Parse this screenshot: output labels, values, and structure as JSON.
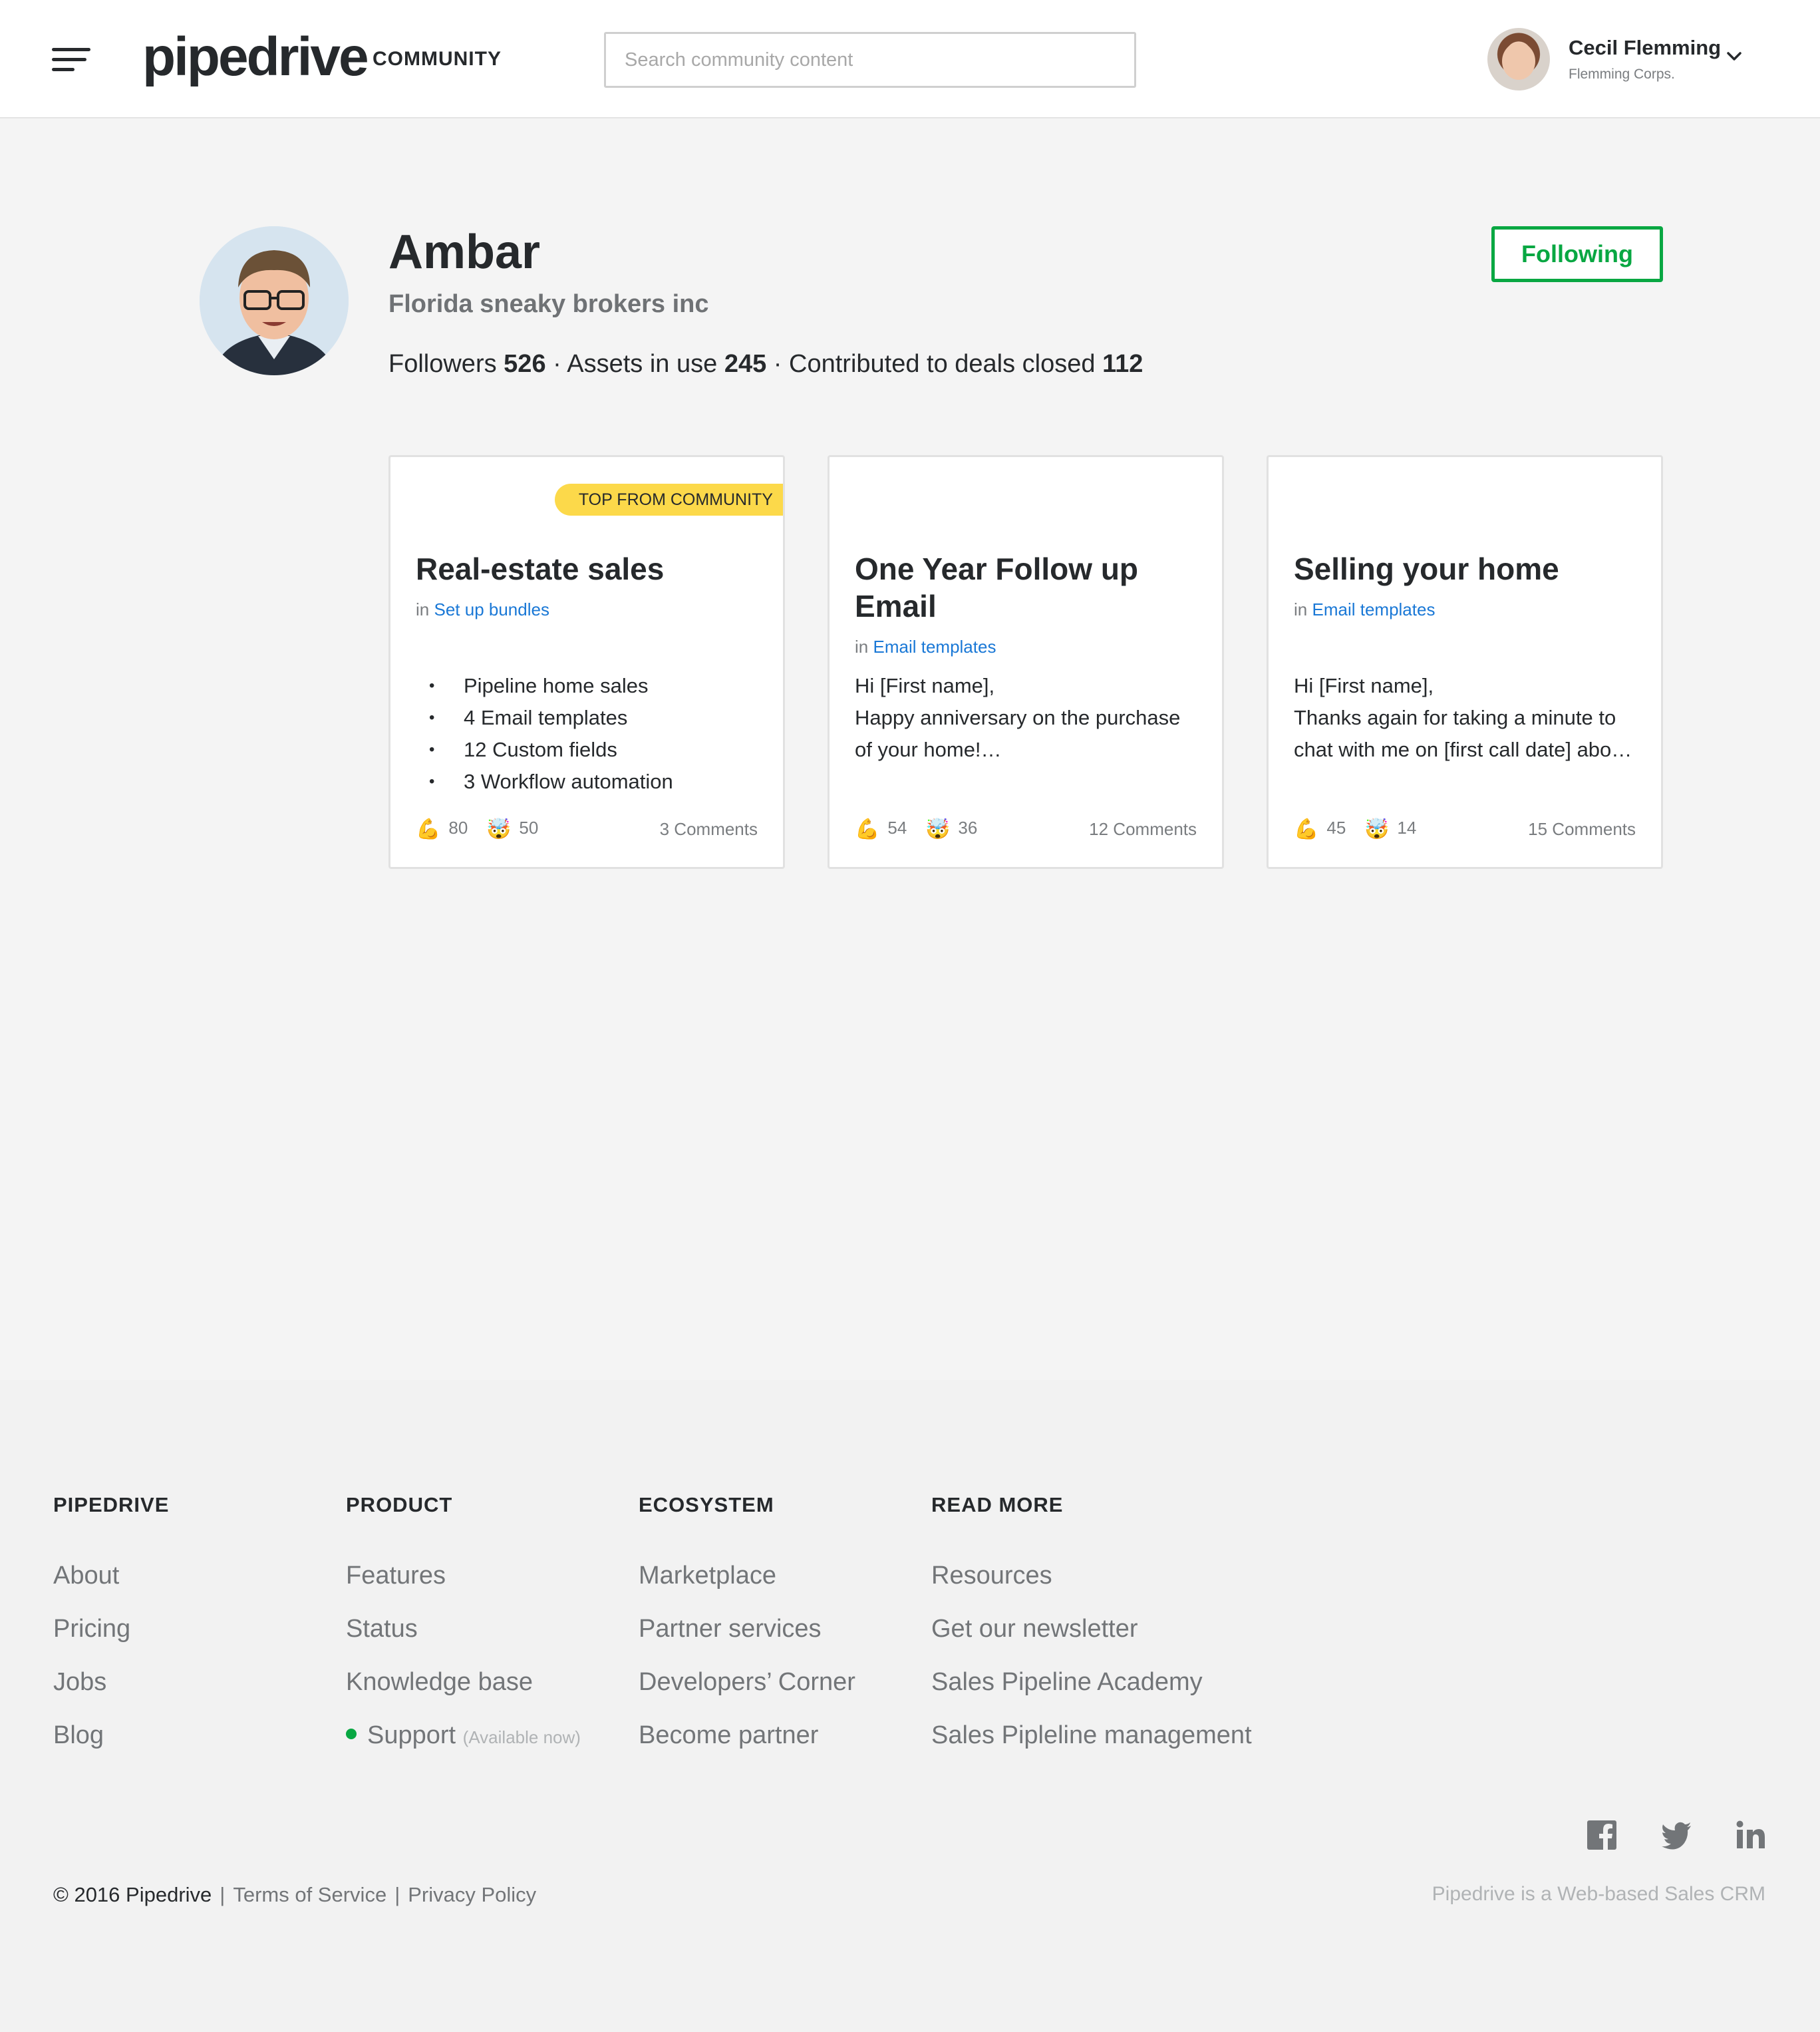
{
  "header": {
    "brand": "pipedrive",
    "brand_sub": "COMMUNITY",
    "search_placeholder": "Search community content",
    "user": {
      "name": "Cecil Flemming",
      "company": "Flemming Corps."
    }
  },
  "profile": {
    "name": "Ambar",
    "company": "Florida sneaky brokers inc",
    "stats": {
      "followers_label": "Followers",
      "followers": "526",
      "assets_label": "Assets in use",
      "assets": "245",
      "deals_label": "Contributed to deals closed",
      "deals": "112"
    },
    "follow_button": "Following"
  },
  "cards": [
    {
      "badge": "TOP FROM COMMUNITY",
      "title": "Real-estate sales",
      "category_prefix": "in",
      "category": "Set up bundles",
      "items": [
        "Pipeline home sales",
        "4 Email templates",
        "12 Custom fields",
        "3 Workflow automation"
      ],
      "reaction1_emoji": "💪",
      "reaction1": "80",
      "reaction2_emoji": "🤯",
      "reaction2": "50",
      "comments": "3 Comments"
    },
    {
      "title": "One Year Follow up Email",
      "category_prefix": "in",
      "category": "Email templates",
      "body": "Hi [First name],\nHappy anniversary on the purchase of your home!…",
      "reaction1_emoji": "💪",
      "reaction1": "54",
      "reaction2_emoji": "🤯",
      "reaction2": "36",
      "comments": "12 Comments"
    },
    {
      "title": "Selling your home",
      "category_prefix": "in",
      "category": "Email templates",
      "body": "Hi [First name],\nThanks again for taking a minute to chat with me on [first call date] abo…",
      "reaction1_emoji": "💪",
      "reaction1": "45",
      "reaction2_emoji": "🤯",
      "reaction2": "14",
      "comments": "15 Comments"
    }
  ],
  "footer": {
    "columns": [
      {
        "heading": "PIPEDRIVE",
        "links": [
          "About",
          "Pricing",
          "Jobs",
          "Blog"
        ]
      },
      {
        "heading": "PRODUCT",
        "links": [
          "Features",
          "Status",
          "Knowledge base"
        ],
        "support": "Support",
        "support_note": "(Available now)"
      },
      {
        "heading": "ECOSYSTEM",
        "links": [
          "Marketplace",
          "Partner services",
          "Developers’ Corner",
          "Become partner"
        ]
      },
      {
        "heading": "READ MORE",
        "links": [
          "Resources",
          "Get our newsletter",
          "Sales Pipeline Academy",
          "Sales Pipleline management"
        ]
      }
    ],
    "copyright": "© 2016 Pipedrive",
    "terms": "Terms of Service",
    "privacy": "Privacy Policy",
    "tagline": "Pipedrive is a Web-based Sales CRM",
    "social": [
      "facebook-icon",
      "twitter-icon",
      "linkedin-icon"
    ]
  },
  "colors": {
    "accent_green": "#08a742",
    "link_blue": "#1a78d6",
    "badge_yellow": "#fcd94a"
  }
}
